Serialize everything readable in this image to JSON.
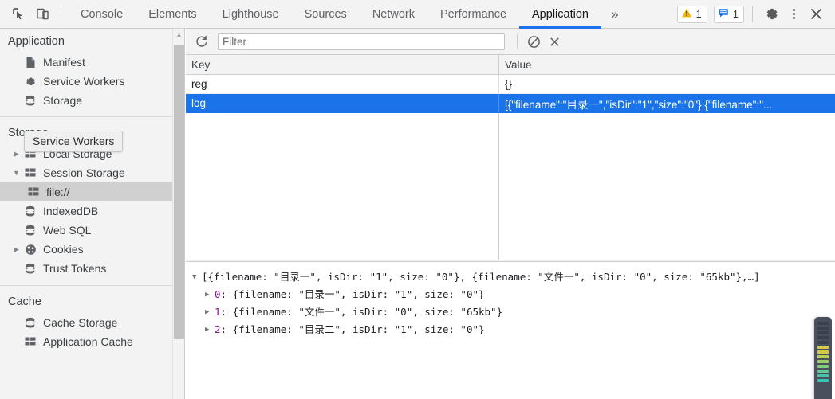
{
  "topbar": {
    "left_icons": [
      {
        "name": "inspect-element-icon"
      },
      {
        "name": "device-toolbar-icon"
      }
    ],
    "tabs": [
      {
        "label": "Console",
        "active": false
      },
      {
        "label": "Elements",
        "active": false
      },
      {
        "label": "Lighthouse",
        "active": false
      },
      {
        "label": "Sources",
        "active": false
      },
      {
        "label": "Network",
        "active": false
      },
      {
        "label": "Performance",
        "active": false
      },
      {
        "label": "Application",
        "active": true
      }
    ],
    "more_tabs_label": "»",
    "warning_count": "1",
    "message_count": "1",
    "settings_label": "",
    "menu_label": "",
    "close_label": "",
    "accent_color": "#1a73e8",
    "warning_color": "#f5b400",
    "message_color": "#1a73e8"
  },
  "sidebar": {
    "sections": [
      {
        "title": "Application",
        "items": [
          {
            "label": "Manifest",
            "icon": "document-icon",
            "indent": 1,
            "twisty": "none",
            "selected": false
          },
          {
            "label": "Service Workers",
            "icon": "gear-icon",
            "indent": 1,
            "twisty": "none",
            "selected": false
          },
          {
            "label": "Storage",
            "icon": "database-icon",
            "indent": 1,
            "twisty": "none",
            "selected": false
          }
        ]
      },
      {
        "title": "Storage",
        "items": [
          {
            "label": "Local Storage",
            "icon": "table-icon",
            "indent": 1,
            "twisty": "collapsed",
            "selected": false
          },
          {
            "label": "Session Storage",
            "icon": "table-icon",
            "indent": 1,
            "twisty": "expanded",
            "selected": false
          },
          {
            "label": "file://",
            "icon": "table-icon",
            "indent": 2,
            "twisty": "none",
            "selected": true
          },
          {
            "label": "IndexedDB",
            "icon": "database-icon",
            "indent": 1,
            "twisty": "none",
            "selected": false
          },
          {
            "label": "Web SQL",
            "icon": "database-icon",
            "indent": 1,
            "twisty": "none",
            "selected": false
          },
          {
            "label": "Cookies",
            "icon": "cookie-icon",
            "indent": 1,
            "twisty": "collapsed",
            "selected": false
          },
          {
            "label": "Trust Tokens",
            "icon": "database-icon",
            "indent": 1,
            "twisty": "none",
            "selected": false
          }
        ]
      },
      {
        "title": "Cache",
        "items": [
          {
            "label": "Cache Storage",
            "icon": "database-icon",
            "indent": 1,
            "twisty": "none",
            "selected": false
          },
          {
            "label": "Application Cache",
            "icon": "table-icon",
            "indent": 1,
            "twisty": "none",
            "selected": false
          }
        ]
      }
    ],
    "tooltip": "Service Workers"
  },
  "toolbar": {
    "refresh_label": "",
    "filter_placeholder": "Filter",
    "filter_value": "",
    "clear_label": "",
    "delete_label": ""
  },
  "table": {
    "columns": [
      "Key",
      "Value"
    ],
    "rows": [
      {
        "key": "reg",
        "value": "{}",
        "selected": false
      },
      {
        "key": "log",
        "value": "[{\"filename\":\"目录一\",\"isDir\":\"1\",\"size\":\"0\"},{\"filename\":\"...",
        "selected": true
      }
    ]
  },
  "preview": {
    "root": "[{filename: \"目录一\", isDir: \"1\", size: \"0\"}, {filename: \"文件一\", isDir: \"0\", size: \"65kb\"},…]",
    "children": [
      {
        "index": "0",
        "text": ": {filename: \"目录一\", isDir: \"1\", size: \"0\"}"
      },
      {
        "index": "1",
        "text": ": {filename: \"文件一\", isDir: \"0\", size: \"65kb\"}"
      },
      {
        "index": "2",
        "text": ": {filename: \"目录二\", isDir: \"1\", size: \"0\"}"
      }
    ]
  },
  "vu_meter": {
    "name": "level-meter-widget",
    "segments": [
      "#3a3f4d",
      "#3a3f4d",
      "#3a3f4d",
      "#3a3f4d",
      "#3a3f4d",
      "#d8c84a",
      "#d8c84a",
      "#b9cf55",
      "#9ccc62",
      "#7fca78",
      "#5fc894",
      "#43c6a8",
      "#35c4b4"
    ]
  }
}
